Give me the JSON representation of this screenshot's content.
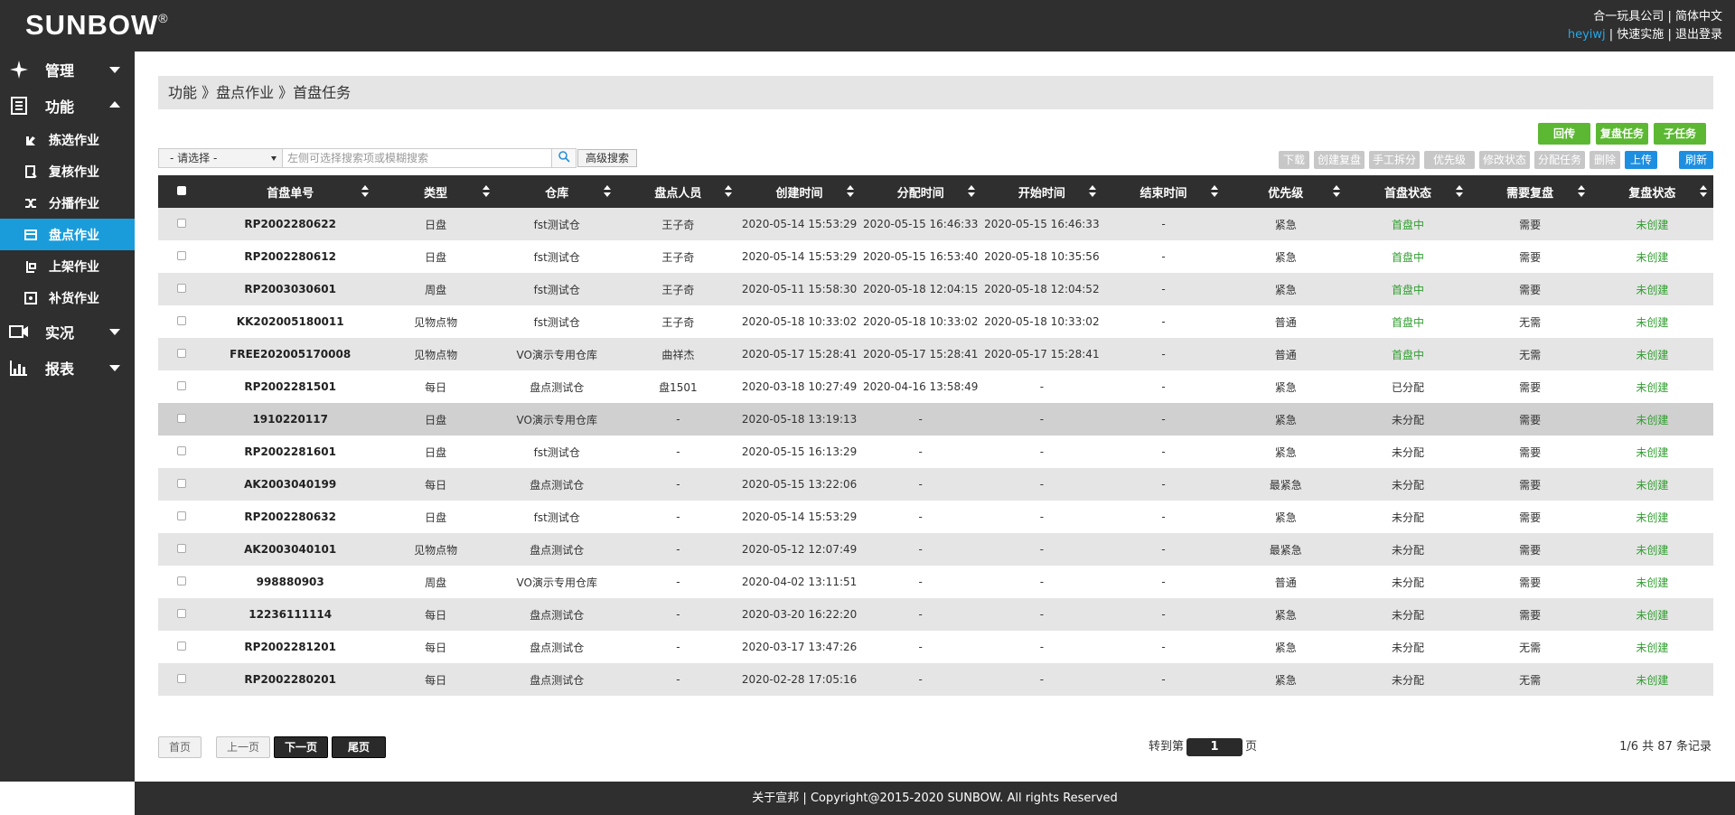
{
  "header": {
    "logo": "SUNBOW",
    "logo_mark": "®",
    "company": "合一玩具公司",
    "language": "简体中文",
    "username": "heyiwj",
    "quick_impl": "快速实施",
    "logout": "退出登录",
    "sep": "|"
  },
  "sidebar": {
    "groups": [
      {
        "label": "管理",
        "icon": "compass-icon"
      },
      {
        "label": "功能",
        "icon": "document-icon"
      },
      {
        "label": "实况",
        "icon": "camera-icon"
      },
      {
        "label": "报表",
        "icon": "bar-chart-icon"
      }
    ],
    "items": [
      {
        "label": "拣选作业",
        "icon": "pick-icon"
      },
      {
        "label": "复核作业",
        "icon": "review-icon"
      },
      {
        "label": "分播作业",
        "icon": "shuffle-icon"
      },
      {
        "label": "盘点作业",
        "icon": "inventory-icon"
      },
      {
        "label": "上架作业",
        "icon": "shelf-icon"
      },
      {
        "label": "补货作业",
        "icon": "replenish-icon"
      }
    ],
    "active_item": "盘点作业"
  },
  "breadcrumb": "功能 》盘点作业 》首盘任务",
  "actions": {
    "callback": "回传",
    "recheck_task": "复盘任务",
    "sub_task": "子任务"
  },
  "search": {
    "select_value": "- 请选择 -",
    "placeholder": "左侧可选择搜索项或模糊搜索",
    "advanced": "高级搜索"
  },
  "toolbar": {
    "download": "下载",
    "create_recheck": "创建复盘",
    "manual_split": "手工拆分",
    "priority": "优先级",
    "modify_status": "修改状态",
    "assign_task": "分配任务",
    "delete": "删除",
    "upload": "上传",
    "refresh": "刷新"
  },
  "table": {
    "columns": [
      "首盘单号",
      "类型",
      "仓库",
      "盘点人员",
      "创建时间",
      "分配时间",
      "开始时间",
      "结束时间",
      "优先级",
      "首盘状态",
      "需要复盘",
      "复盘状态"
    ],
    "rows": [
      [
        "RP2002280622",
        "日盘",
        "fst测试仓",
        "王子奇",
        "2020-05-14 15:53:29",
        "2020-05-15 16:46:33",
        "2020-05-15 16:46:33",
        "-",
        "紧急",
        "首盘中",
        "需要",
        "未创建"
      ],
      [
        "RP2002280612",
        "日盘",
        "fst测试仓",
        "王子奇",
        "2020-05-14 15:53:29",
        "2020-05-15 16:53:40",
        "2020-05-18 10:35:56",
        "-",
        "紧急",
        "首盘中",
        "需要",
        "未创建"
      ],
      [
        "RP2003030601",
        "周盘",
        "fst测试仓",
        "王子奇",
        "2020-05-11 15:58:30",
        "2020-05-18 12:04:15",
        "2020-05-18 12:04:52",
        "-",
        "紧急",
        "首盘中",
        "需要",
        "未创建"
      ],
      [
        "KK202005180011",
        "见物点物",
        "fst测试仓",
        "王子奇",
        "2020-05-18 10:33:02",
        "2020-05-18 10:33:02",
        "2020-05-18 10:33:02",
        "-",
        "普通",
        "首盘中",
        "无需",
        "未创建"
      ],
      [
        "FREE202005170008",
        "见物点物",
        "VO演示专用仓库",
        "曲祥杰",
        "2020-05-17 15:28:41",
        "2020-05-17 15:28:41",
        "2020-05-17 15:28:41",
        "-",
        "普通",
        "首盘中",
        "无需",
        "未创建"
      ],
      [
        "RP2002281501",
        "每日",
        "盘点测试仓",
        "盘1501",
        "2020-03-18 10:27:49",
        "2020-04-16 13:58:49",
        "-",
        "-",
        "紧急",
        "已分配",
        "需要",
        "未创建"
      ],
      [
        "1910220117",
        "日盘",
        "VO演示专用仓库",
        "-",
        "2020-05-18 13:19:13",
        "-",
        "-",
        "-",
        "紧急",
        "未分配",
        "需要",
        "未创建"
      ],
      [
        "RP2002281601",
        "日盘",
        "fst测试仓",
        "-",
        "2020-05-15 16:13:29",
        "-",
        "-",
        "-",
        "紧急",
        "未分配",
        "需要",
        "未创建"
      ],
      [
        "AK2003040199",
        "每日",
        "盘点测试仓",
        "-",
        "2020-05-15 13:22:06",
        "-",
        "-",
        "-",
        "最紧急",
        "未分配",
        "需要",
        "未创建"
      ],
      [
        "RP2002280632",
        "日盘",
        "fst测试仓",
        "-",
        "2020-05-14 15:53:29",
        "-",
        "-",
        "-",
        "紧急",
        "未分配",
        "需要",
        "未创建"
      ],
      [
        "AK2003040101",
        "见物点物",
        "盘点测试仓",
        "-",
        "2020-05-12 12:07:49",
        "-",
        "-",
        "-",
        "最紧急",
        "未分配",
        "需要",
        "未创建"
      ],
      [
        "998880903",
        "周盘",
        "VO演示专用仓库",
        "-",
        "2020-04-02 13:11:51",
        "-",
        "-",
        "-",
        "普通",
        "未分配",
        "需要",
        "未创建"
      ],
      [
        "12236111114",
        "每日",
        "盘点测试仓",
        "-",
        "2020-03-20 16:22:20",
        "-",
        "-",
        "-",
        "紧急",
        "未分配",
        "需要",
        "未创建"
      ],
      [
        "RP2002281201",
        "每日",
        "盘点测试仓",
        "-",
        "2020-03-17 13:47:26",
        "-",
        "-",
        "-",
        "紧急",
        "未分配",
        "无需",
        "未创建"
      ],
      [
        "RP2002280201",
        "每日",
        "盘点测试仓",
        "-",
        "2020-02-28 17:05:16",
        "-",
        "-",
        "-",
        "紧急",
        "未分配",
        "无需",
        "未创建"
      ]
    ],
    "highlighted_row": 6,
    "status_color": "#2f9e2f"
  },
  "pager": {
    "first": "首页",
    "prev": "上一页",
    "next": "下一页",
    "last": "尾页",
    "goto_prefix": "转到第",
    "goto_value": "1",
    "goto_suffix": "页",
    "records": "1/6 共 87 条记录"
  },
  "footer": "关于宣邦 | Copyright@2015-2020 SUNBOW. All rights Reserved",
  "colors": {
    "dark": "#2f2f2f",
    "active_blue": "#1a9cdb",
    "green_button": "#5cb833",
    "blue_button": "#1e8fe0"
  }
}
